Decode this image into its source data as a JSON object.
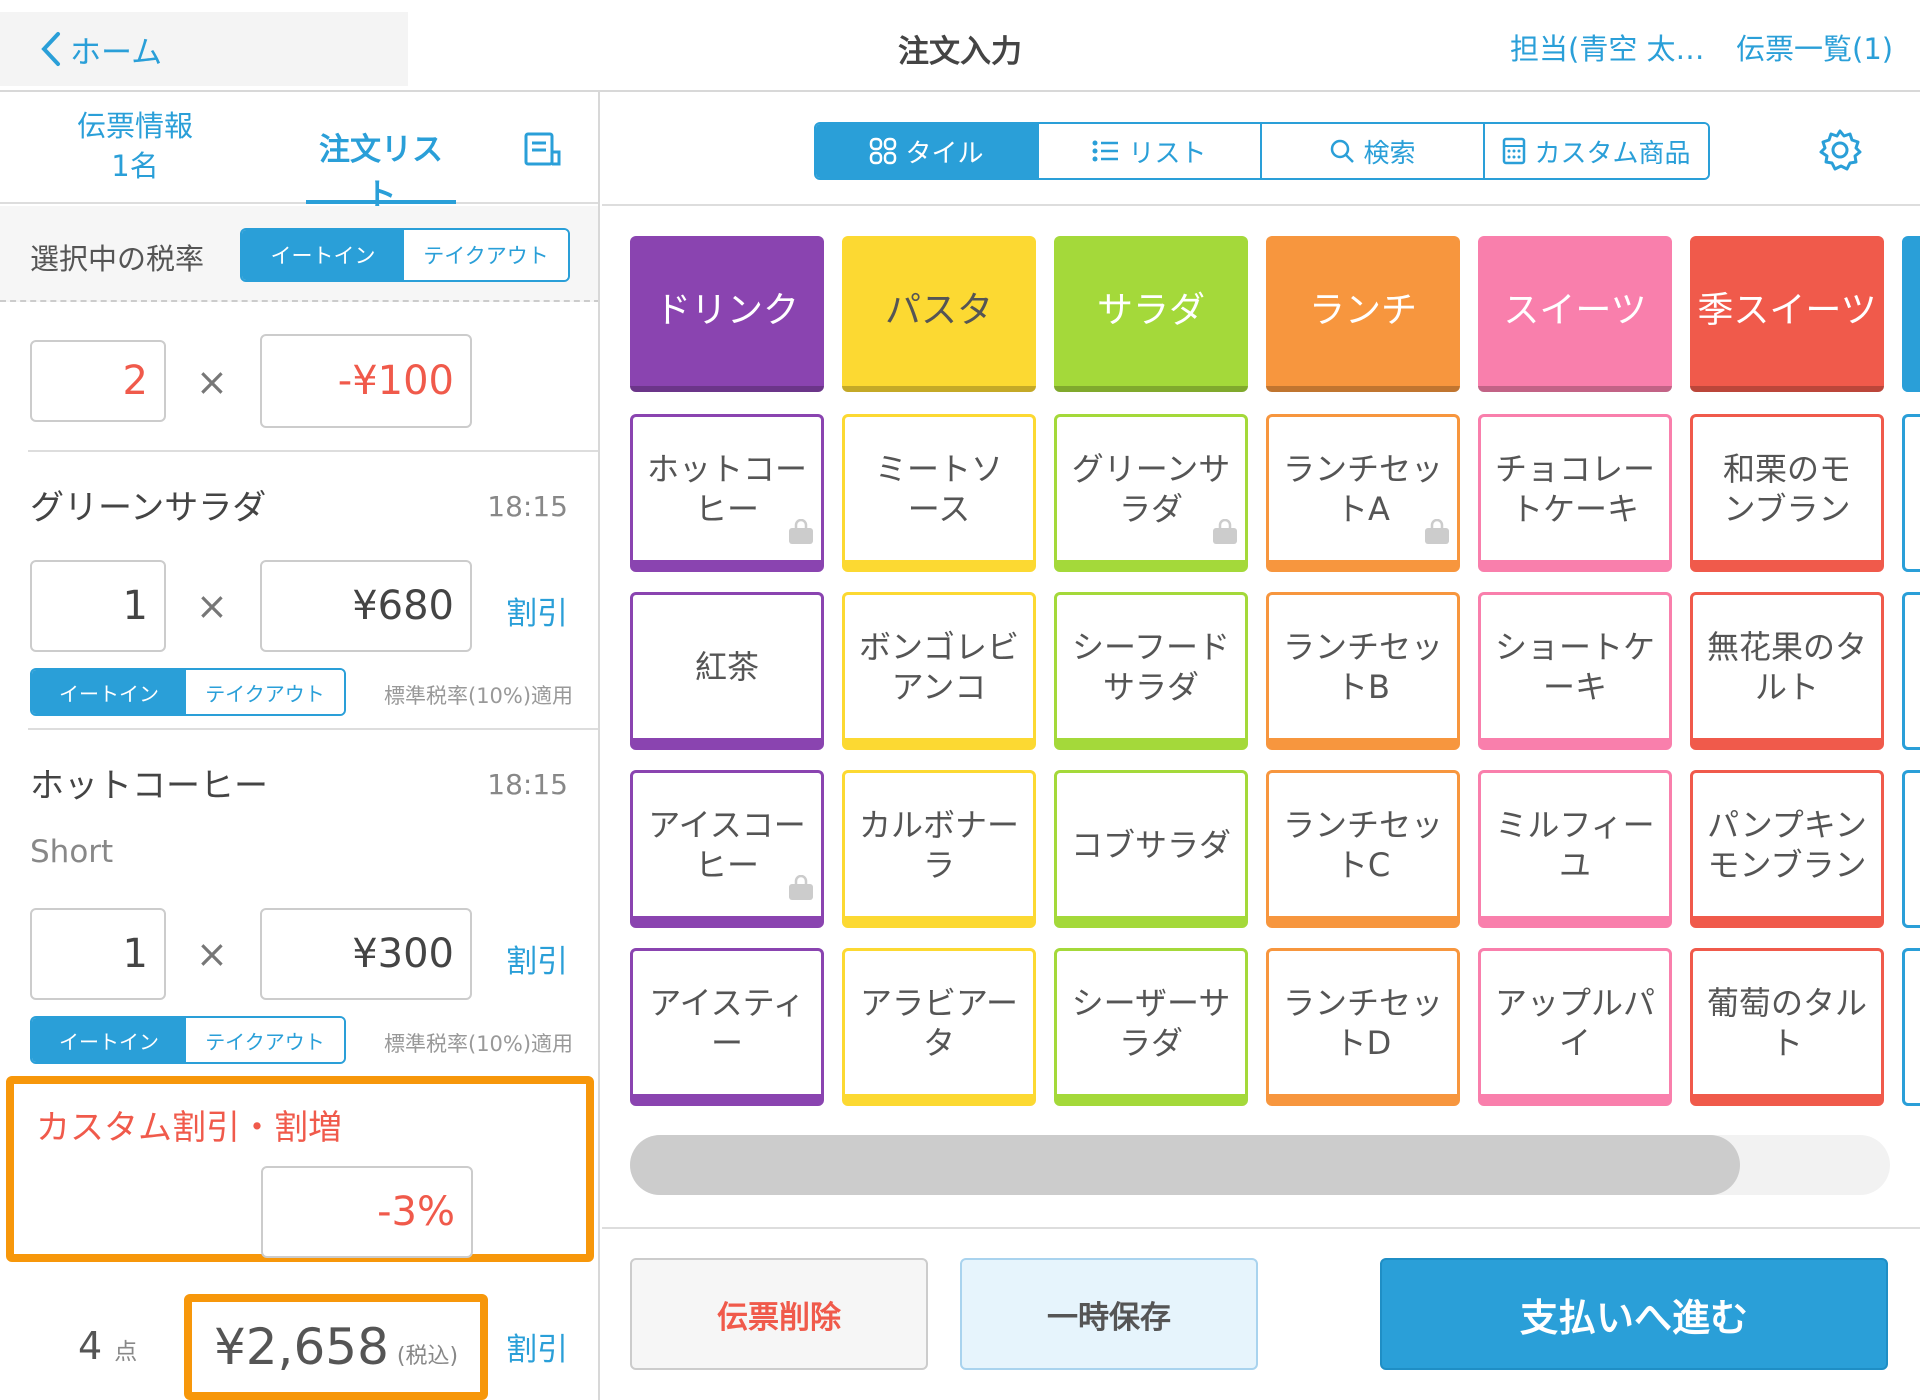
{
  "header": {
    "back_label": "ホーム",
    "title": "注文入力",
    "staff": "担当(青空 太…",
    "slip_list": "伝票一覧(1)"
  },
  "left_tabs": {
    "info_line1": "伝票情報",
    "info_line2": "1名",
    "order_list": "注文リスト"
  },
  "tax_rate": {
    "label": "選択中の税率",
    "eat_in": "イートイン",
    "take_out": "テイクアウト"
  },
  "discount_row": {
    "qty": "2",
    "times": "×",
    "price": "-¥100"
  },
  "items": [
    {
      "name": "グリーンサラダ",
      "time": "18:15",
      "option": "",
      "qty": "1",
      "times": "×",
      "price": "¥680",
      "discount": "割引",
      "eat_in": "イートイン",
      "take_out": "テイクアウト",
      "tax_note": "標準税率(10%)適用"
    },
    {
      "name": "ホットコーヒー",
      "time": "18:15",
      "option": "Short",
      "qty": "1",
      "times": "×",
      "price": "¥300",
      "discount": "割引",
      "eat_in": "イートイン",
      "take_out": "テイクアウト",
      "tax_note": "標準税率(10%)適用"
    }
  ],
  "custom_discount": {
    "label": "カスタム割引・割増",
    "value": "-3%"
  },
  "footer": {
    "count": "4",
    "count_unit": "点",
    "total": "¥2,658",
    "tax_incl": "(税込)",
    "discount": "割引"
  },
  "view_tabs": [
    "タイル",
    "リスト",
    "検索",
    "カスタム商品"
  ],
  "categories": [
    {
      "label": "ドリンク",
      "color": "#8a44b0"
    },
    {
      "label": "パスタ",
      "color": "#fcd932"
    },
    {
      "label": "サラダ",
      "color": "#a4d93a"
    },
    {
      "label": "ランチ",
      "color": "#f7963e"
    },
    {
      "label": "スイーツ",
      "color": "#f97fac"
    },
    {
      "label": "季スイーツ",
      "color": "#f05a4b"
    }
  ],
  "products": [
    [
      "ホットコーヒー",
      "ミートソース",
      "グリーンサラダ",
      "ランチセットA",
      "チョコレートケーキ",
      "和栗のモンブラン"
    ],
    [
      "紅茶",
      "ボンゴレビアンコ",
      "シーフードサラダ",
      "ランチセットB",
      "ショートケーキ",
      "無花果のタルト"
    ],
    [
      "アイスコーヒー",
      "カルボナーラ",
      "コブサラダ",
      "ランチセットC",
      "ミルフィーユ",
      "パンプキンモンブラン"
    ],
    [
      "アイスティー",
      "アラビアータ",
      "シーザーサラダ",
      "ランチセットD",
      "アップルパイ",
      "葡萄のタルト"
    ]
  ],
  "buttons": {
    "delete": "伝票削除",
    "hold": "一時保存",
    "pay": "支払いへ進む"
  }
}
